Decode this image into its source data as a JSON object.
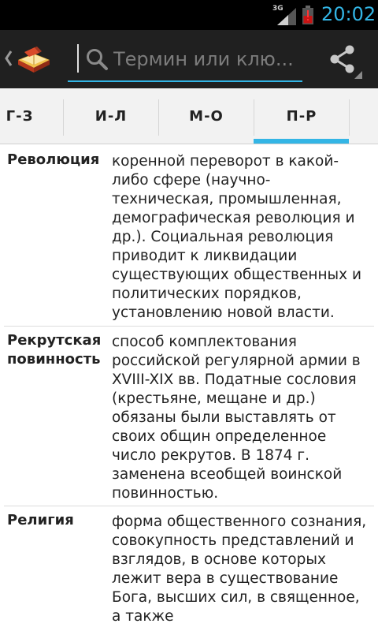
{
  "status_bar": {
    "network_type": "3G",
    "time": "20:02",
    "battery_color": "#c81414",
    "accent": "#33b5e5"
  },
  "action_bar": {
    "up_icon": "chevron-left-icon",
    "logo_icon": "open-book-icon",
    "search_placeholder": "Термин или клю...",
    "search_icon": "search-icon",
    "share_icon": "share-icon"
  },
  "tabs": [
    {
      "label": "Г-З",
      "selected": false
    },
    {
      "label": "И-Л",
      "selected": false
    },
    {
      "label": "М-О",
      "selected": false
    },
    {
      "label": "П-Р",
      "selected": true
    }
  ],
  "entries": [
    {
      "term": "Революция",
      "definition": "коренной переворот в какой-либо сфере (научно-техническая, промышленная, демографическая революция и др.). Социальная революция приводит к ликвидации существующих общественных и политических порядков, установлению новой власти."
    },
    {
      "term": "Рекрутская повинность",
      "definition": "способ комплектования российской регулярной армии в XVIII-XIX вв. Податные сословия (крестьяне, мещане и др.) обязаны были выставлять от своих общин определенное число рекрутов. В 1874 г. заменена всеобщей воинской повинностью."
    },
    {
      "term": "Религия",
      "definition": "форма общественного сознания, совокупность представлений и взглядов, в основе которых лежит вера в существование Бога, высших сил, в священное, а также"
    }
  ]
}
